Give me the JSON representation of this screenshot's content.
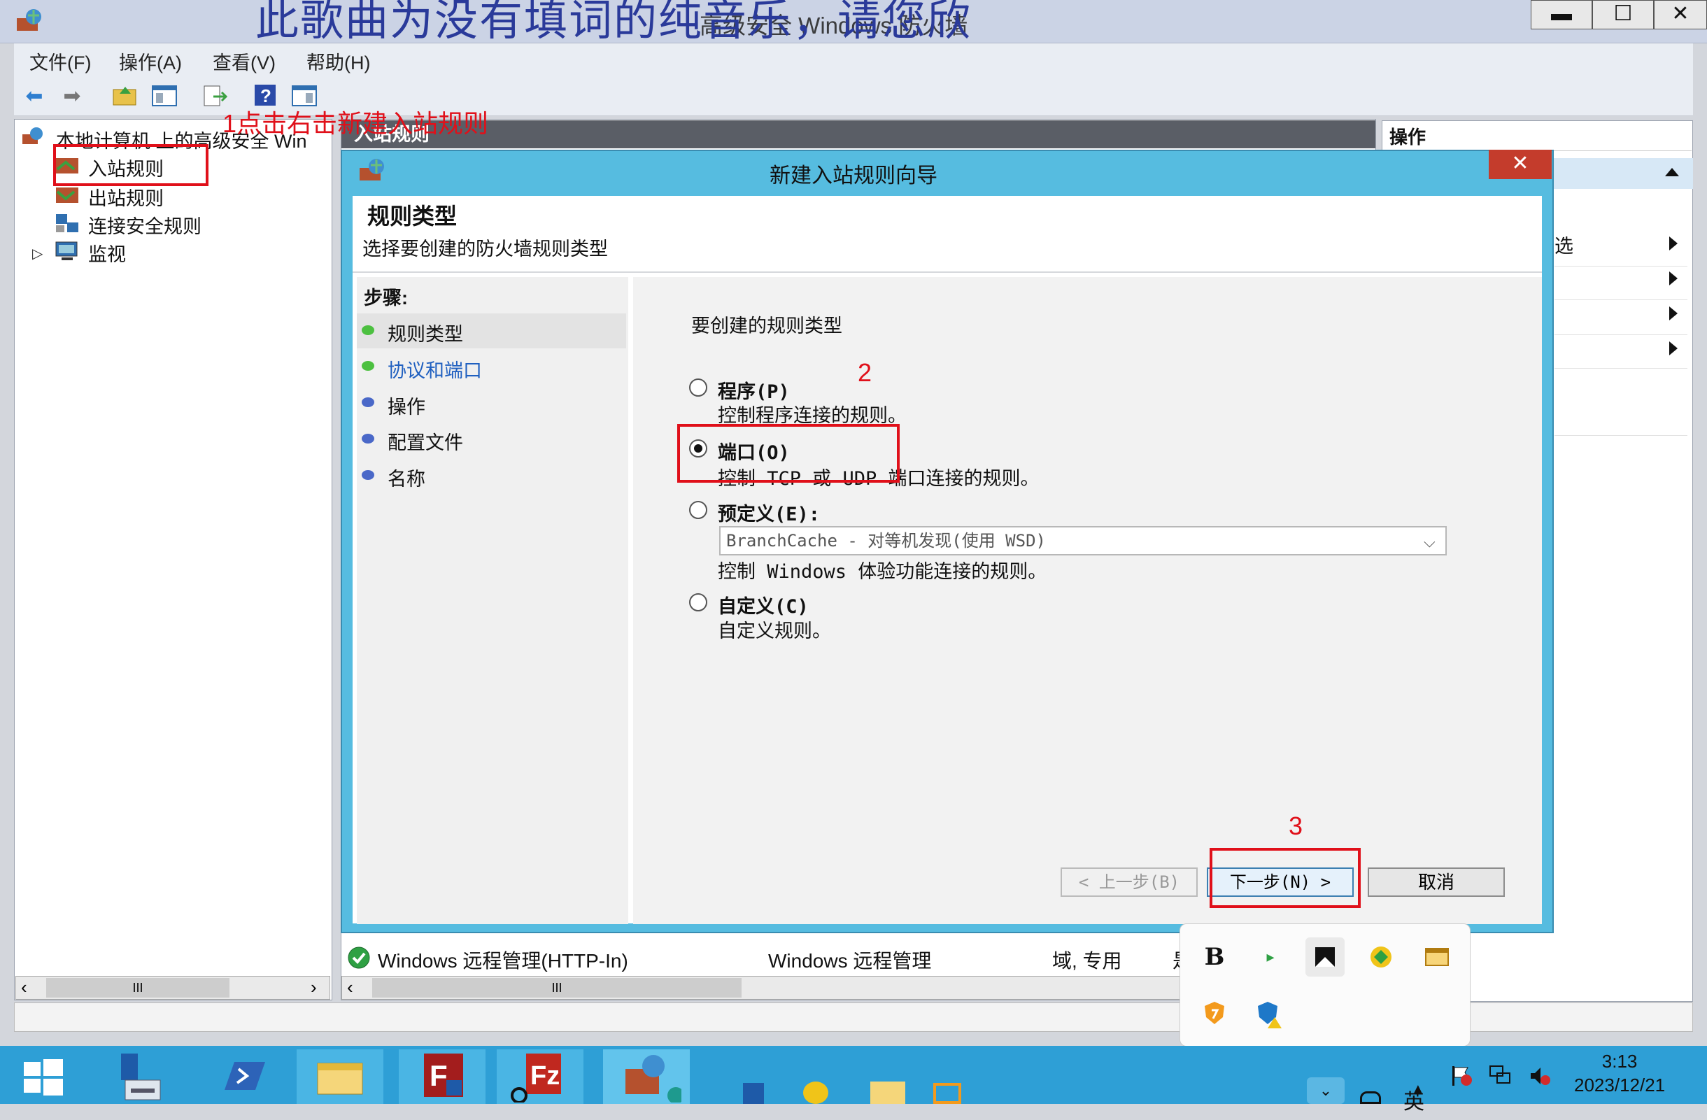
{
  "window": {
    "overlay_caption": "此歌曲为没有填词的纯音乐，请您欣",
    "title": "高级安全 Windows 防火墙",
    "min": "▬",
    "max": "☐",
    "close": "✕"
  },
  "menu": [
    "文件(F)",
    "操作(A)",
    "查看(V)",
    "帮助(H)"
  ],
  "tree": {
    "root": "本地计算机 上的高级安全 Win",
    "items": [
      "入站规则",
      "出站规则",
      "连接安全规则",
      "监视"
    ]
  },
  "annotations": {
    "step1": "1点击右击新建入站规则",
    "step2": "2",
    "step3": "3"
  },
  "middle": {
    "header": "入站规则"
  },
  "right": {
    "header": "操作",
    "partial_item": "选"
  },
  "dialog": {
    "title": "新建入站规则向导",
    "close": "✕",
    "heading": "规则类型",
    "subheading": "选择要创建的防火墙规则类型",
    "steps_label": "步骤:",
    "steps": [
      "规则类型",
      "协议和端口",
      "操作",
      "配置文件",
      "名称"
    ],
    "prompt": "要创建的规则类型",
    "options": [
      {
        "label": "程序(P)",
        "desc": "控制程序连接的规则。"
      },
      {
        "label": "端口(O)",
        "desc": "控制 TCP 或 UDP 端口连接的规则。"
      },
      {
        "label": "预定义(E):",
        "desc": "控制 Windows 体验功能连接的规则。"
      },
      {
        "label": "自定义(C)",
        "desc": "自定义规则。"
      }
    ],
    "selected_option": "端口(O)",
    "predefined_value": "BranchCache - 对等机发现(使用 WSD)",
    "buttons": {
      "back": "< 上一步(B)",
      "next": "下一步(N) >",
      "cancel": "取消"
    }
  },
  "table_row": {
    "name": "Windows 远程管理(HTTP-In)",
    "group": "Windows 远程管理",
    "profile": "域, 专用",
    "extra": "是"
  },
  "scrollbar_grip": "III",
  "taskbar": {
    "time": "3:13",
    "date": "2023/12/21",
    "ime": "英"
  },
  "colors": {
    "dialog_frame": "#56bce0",
    "taskbar": "#2e9fd6",
    "annotation_red": "#e0101a",
    "link_blue": "#2060c0"
  }
}
